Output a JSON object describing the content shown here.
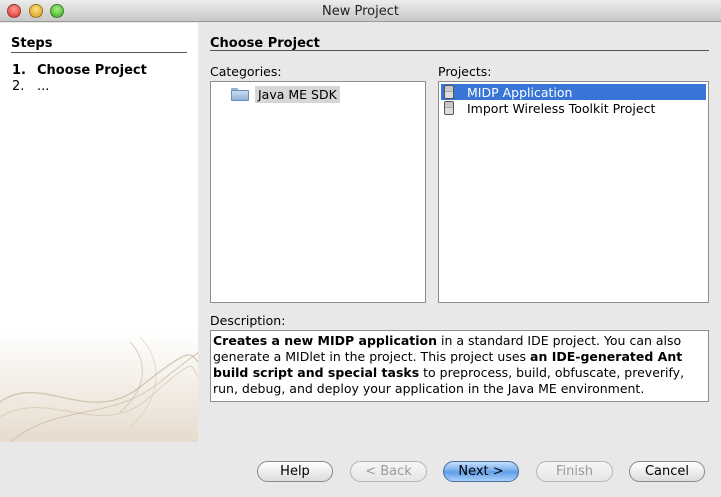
{
  "window": {
    "title": "New Project"
  },
  "steps": {
    "heading": "Steps",
    "items": [
      {
        "num": "1.",
        "label": "Choose Project"
      },
      {
        "num": "2.",
        "label": "..."
      }
    ]
  },
  "main": {
    "title": "Choose Project",
    "categories_label": "Categories:",
    "categories": [
      {
        "label": "Java ME SDK",
        "icon": "folder-icon"
      }
    ],
    "projects_label": "Projects:",
    "projects": [
      {
        "label": "MIDP Application",
        "icon": "mobile-device-icon",
        "selected": true
      },
      {
        "label": "Import Wireless Toolkit Project",
        "icon": "mobile-device-icon",
        "selected": false
      }
    ],
    "description_label": "Description:",
    "description": {
      "b1": "Creates a new MIDP application",
      "t1": " in a standard IDE project. You can also generate a MIDlet in the project. This project uses ",
      "b2": "an IDE-generated Ant build script and special tasks",
      "t2": " to preprocess, build, obfuscate, preverify, run, debug, and deploy your application in the Java ME environment."
    }
  },
  "buttons": {
    "help": "Help",
    "back": "< Back",
    "next": "Next >",
    "finish": "Finish",
    "cancel": "Cancel"
  },
  "colors": {
    "selection": "#3875d7",
    "default_button": "#6fa8e8"
  }
}
